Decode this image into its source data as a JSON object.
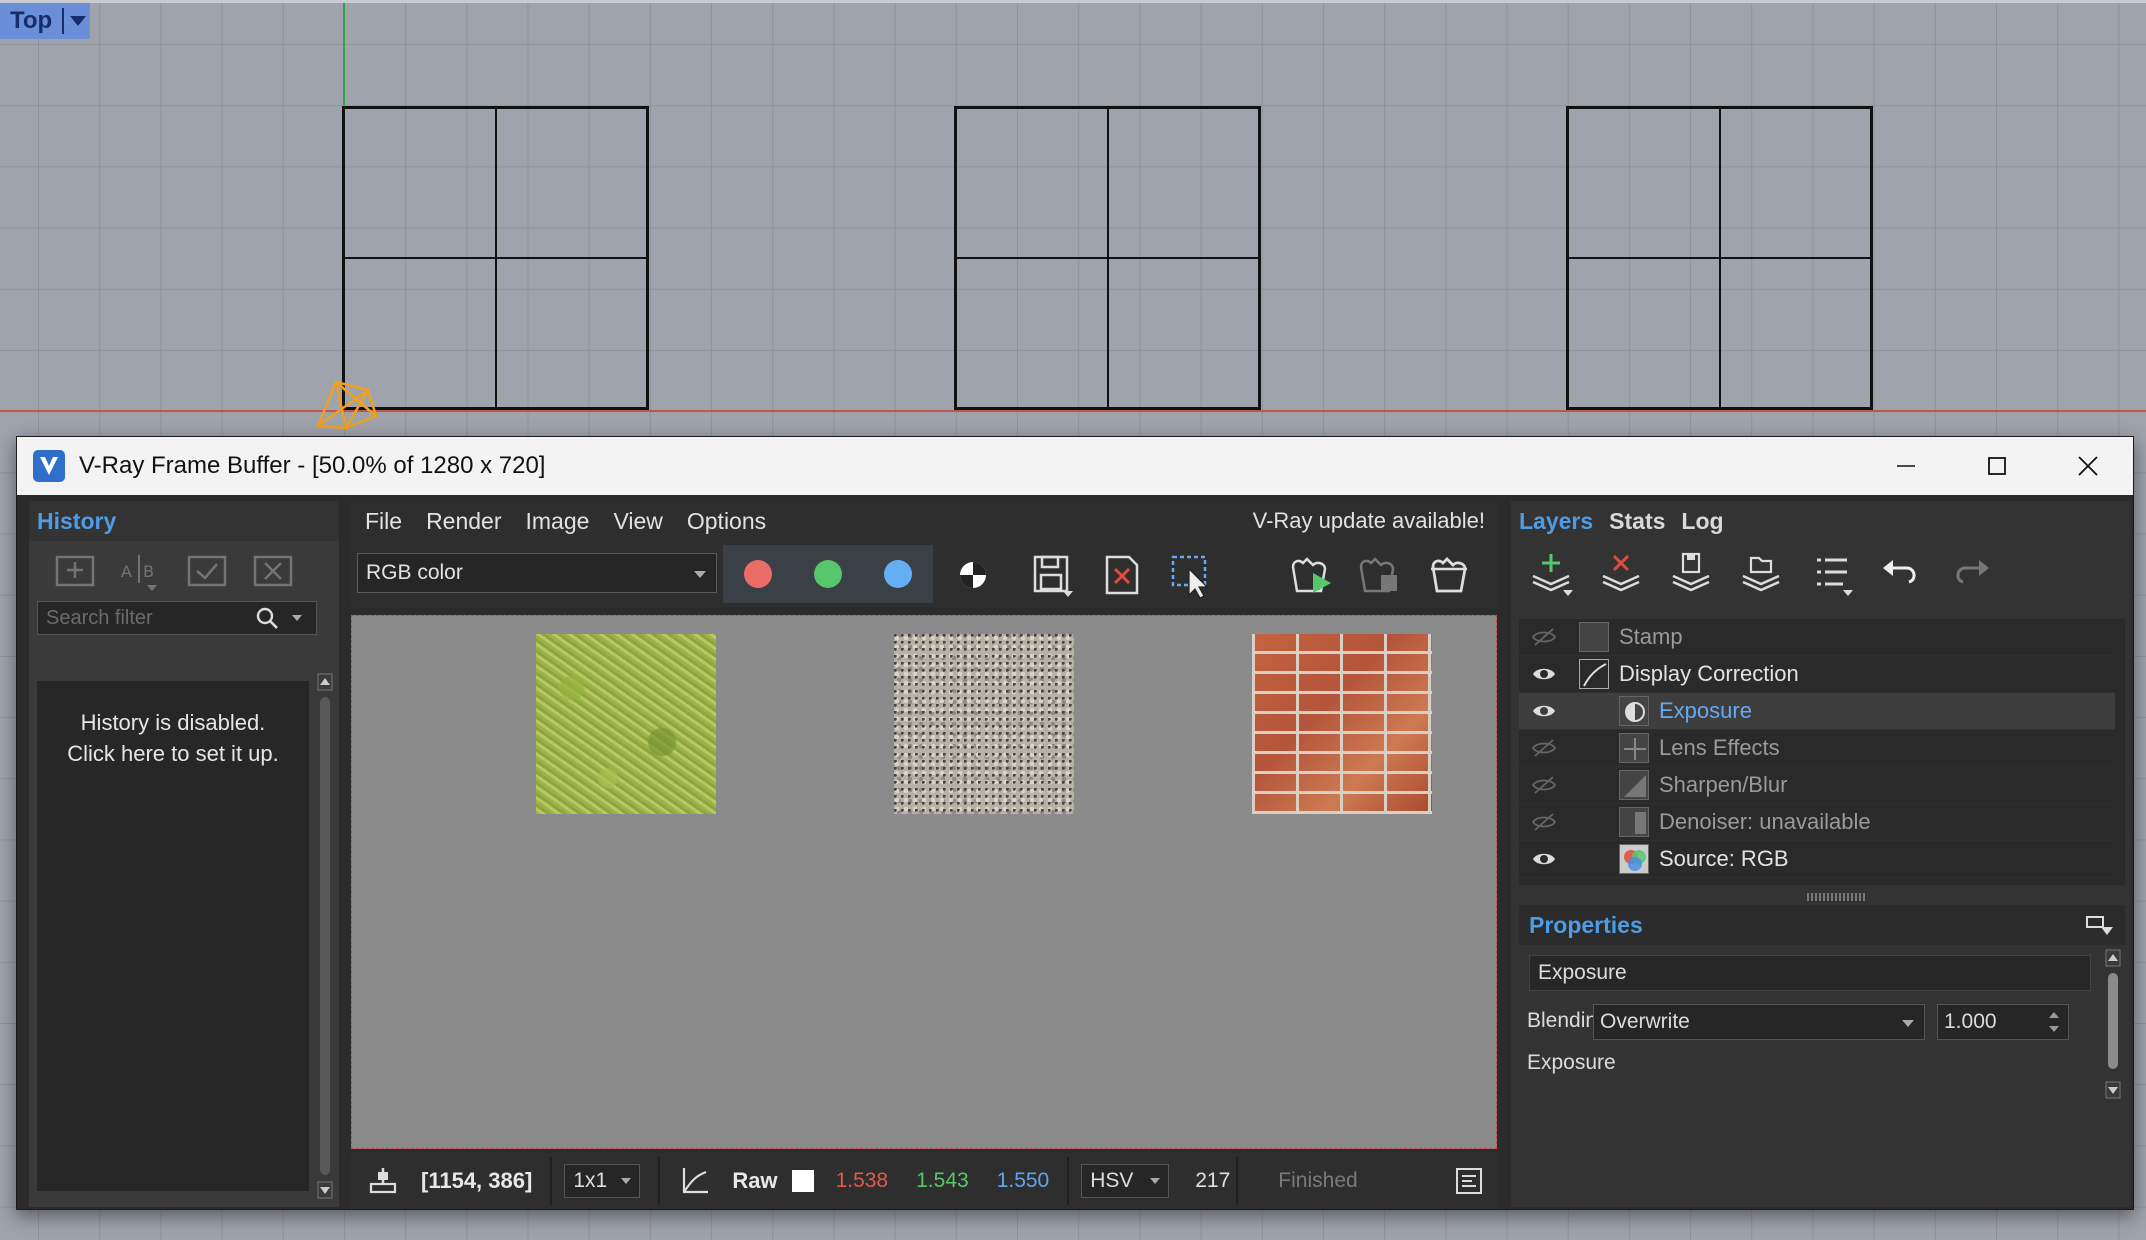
{
  "viewport": {
    "view_name": "Top"
  },
  "vfb": {
    "title": "V-Ray Frame Buffer - [50.0% of 1280 x 720]",
    "menu": [
      "File",
      "Render",
      "Image",
      "View",
      "Options"
    ],
    "update_notice": "V-Ray update available!",
    "channel": "RGB color",
    "channel_colors": {
      "red": "#ea6d67",
      "green": "#58c66c",
      "blue": "#64aef4"
    }
  },
  "history": {
    "title": "History",
    "search_placeholder": "Search filter",
    "message_line1": "History is disabled.",
    "message_line2": "Click here to set it up."
  },
  "status": {
    "coords": "[1154, 386]",
    "sampling": "1x1",
    "mode": "Raw",
    "r": "1.538",
    "g": "1.543",
    "b": "1.550",
    "color_space": "HSV",
    "value": "217",
    "state": "Finished"
  },
  "layers": {
    "tabs": [
      "Layers",
      "Stats",
      "Log"
    ],
    "items": [
      {
        "name": "Stamp",
        "visible": false
      },
      {
        "name": "Display Correction",
        "visible": true
      },
      {
        "name": "Exposure",
        "visible": true,
        "selected": true
      },
      {
        "name": "Lens Effects",
        "visible": false
      },
      {
        "name": "Sharpen/Blur",
        "visible": false
      },
      {
        "name": "Denoiser: unavailable",
        "visible": false
      },
      {
        "name": "Source: RGB",
        "visible": true
      }
    ]
  },
  "properties": {
    "title": "Properties",
    "layer_name": "Exposure",
    "blending_label": "Blending",
    "blending_mode": "Overwrite",
    "blending_value": "1.000",
    "exposure_label": "Exposure"
  }
}
